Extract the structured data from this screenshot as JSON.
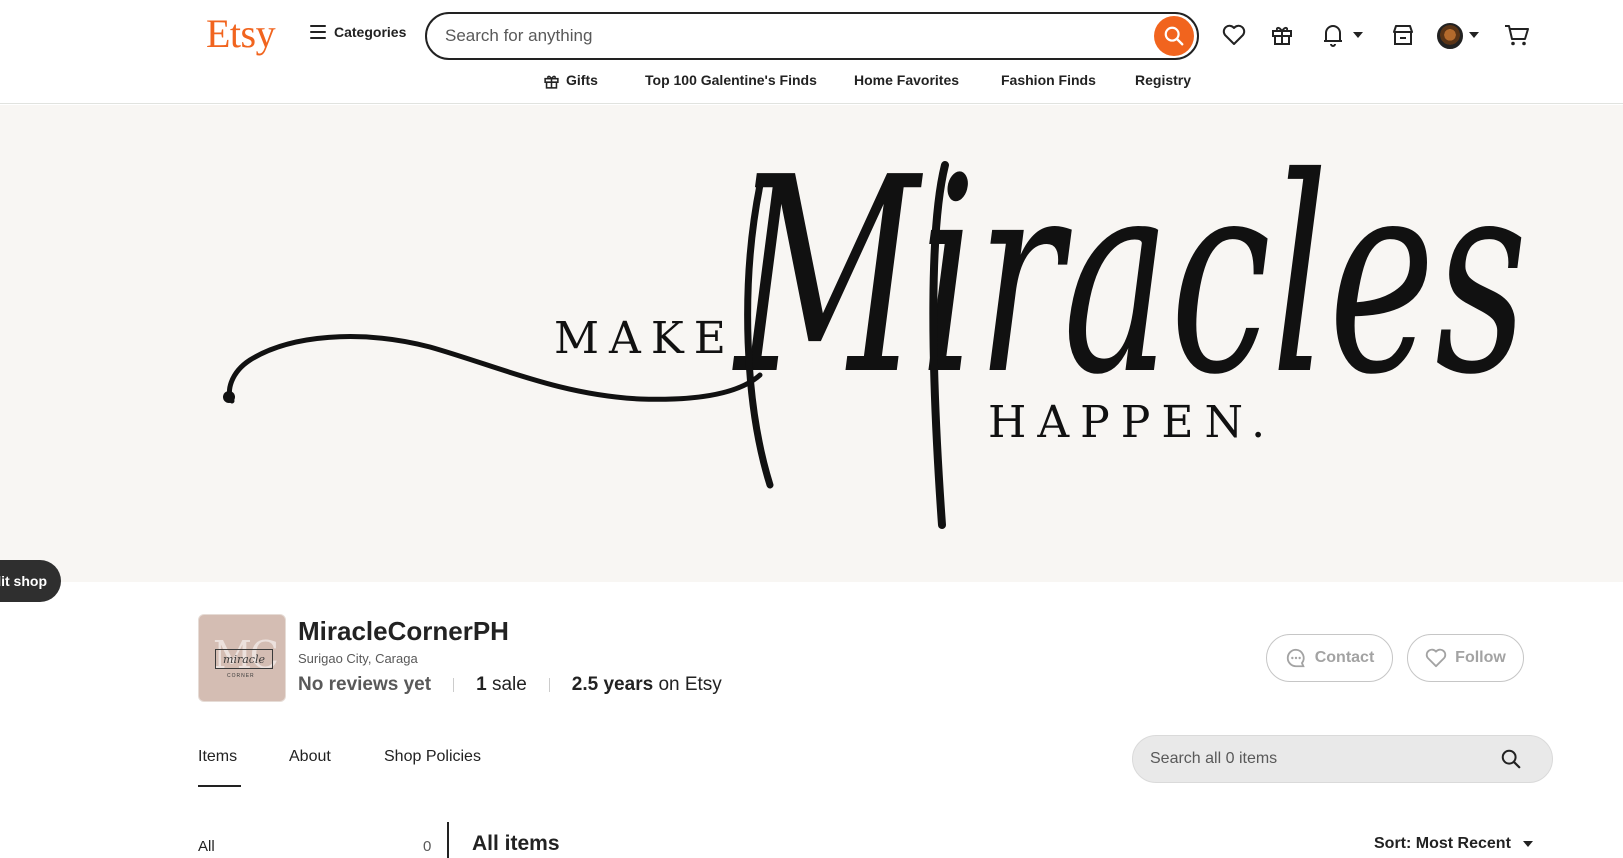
{
  "header": {
    "logo": "Etsy",
    "categories_label": "Categories",
    "search_placeholder": "Search for anything",
    "accent_color": "#F1641E"
  },
  "subnav": {
    "items": [
      "Gifts",
      "Top 100 Galentine's Finds",
      "Home Favorites",
      "Fashion Finds",
      "Registry"
    ]
  },
  "banner": {
    "line1": "MAKE",
    "script_word": "Miracles",
    "line2": "HAPPEN."
  },
  "edit_shop_label": "dit shop",
  "shop": {
    "logo_text": "miracle",
    "logo_monogram": "MC",
    "logo_small": "CORNER",
    "name": "MiracleCornerPH",
    "location": "Surigao City, Caraga",
    "reviews": "No reviews yet",
    "sales_count": "1",
    "sales_label": "sale",
    "years": "2.5 years",
    "years_suffix": "on Etsy",
    "contact_label": "Contact",
    "follow_label": "Follow"
  },
  "tabs": [
    "Items",
    "About",
    "Shop Policies"
  ],
  "shop_search_placeholder": "Search all 0 items",
  "sidebar": {
    "all_label": "All",
    "all_count": "0"
  },
  "main": {
    "heading": "All items",
    "sort_label": "Sort: Most Recent"
  }
}
